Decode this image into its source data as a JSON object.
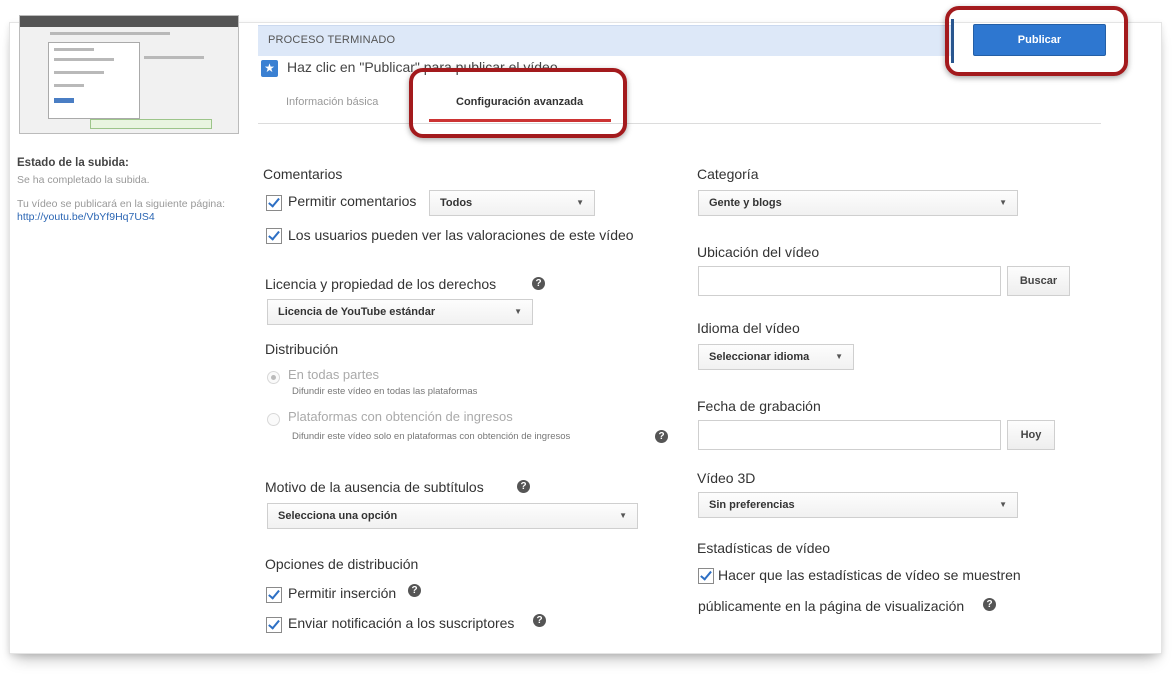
{
  "status": {
    "title": "Estado de la subida:",
    "message": "Se ha completado la subida.",
    "note": "Tu vídeo se publicará en la siguiente página:",
    "link": "http://youtu.be/VbYf9Hq7US4"
  },
  "header": {
    "process_label": "PROCESO TERMINADO",
    "publish_label": "Publicar",
    "hint": "Haz clic en \"Publicar\" para publicar el vídeo."
  },
  "tabs": [
    {
      "label": "Información básica"
    },
    {
      "label": "Configuración avanzada"
    }
  ],
  "comments": {
    "heading": "Comentarios",
    "allow_label": "Permitir comentarios",
    "allow_select": "Todos",
    "ratings_label": "Los usuarios pueden ver las valoraciones de este vídeo"
  },
  "license": {
    "heading": "Licencia y propiedad de los derechos",
    "select": "Licencia de YouTube estándar"
  },
  "distribution": {
    "heading": "Distribución",
    "options": [
      {
        "label": "En todas partes",
        "desc": "Difundir este vídeo en todas las plataformas",
        "selected": true
      },
      {
        "label": "Plataformas con obtención de ingresos",
        "desc": "Difundir este vídeo solo en plataformas con obtención de ingresos",
        "selected": false
      }
    ]
  },
  "subtitles": {
    "heading": "Motivo de la ausencia de subtítulos",
    "select": "Selecciona una opción"
  },
  "distribution_options": {
    "heading": "Opciones de distribución",
    "embed_label": "Permitir inserción",
    "notify_label": "Enviar notificación a los suscriptores"
  },
  "category": {
    "heading": "Categoría",
    "select": "Gente y blogs"
  },
  "location": {
    "heading": "Ubicación del vídeo",
    "value": "",
    "button": "Buscar"
  },
  "language": {
    "heading": "Idioma del vídeo",
    "select": "Seleccionar idioma"
  },
  "recording_date": {
    "heading": "Fecha de grabación",
    "value": "",
    "button": "Hoy"
  },
  "video3d": {
    "heading": "Vídeo 3D",
    "select": "Sin preferencias"
  },
  "stats": {
    "heading": "Estadísticas de vídeo",
    "label_line1": "Hacer que las estadísticas de vídeo se muestren",
    "label_line2": "públicamente en la página de visualización"
  },
  "icons": {
    "star": "star-icon",
    "help": "help-icon",
    "dropdown": "chevron-down-icon"
  },
  "colors": {
    "publish": "#2e77d0",
    "process_bar": "#dde8f8",
    "highlight": "#a31a1d",
    "tab_underline": "#cc3333"
  }
}
